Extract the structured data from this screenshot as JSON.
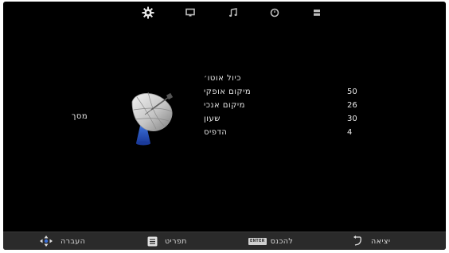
{
  "colors": {
    "background": "#000000",
    "text": "#e8e8e8",
    "bottom_bar": "#2a2a2a",
    "active_tab": "#e6e6e6"
  },
  "tabs": [
    {
      "icon": "gear-icon",
      "active": true
    },
    {
      "icon": "monitor-icon",
      "active": false
    },
    {
      "icon": "music-note-icon",
      "active": false
    },
    {
      "icon": "clock-icon",
      "active": false
    },
    {
      "icon": "lock-icon",
      "active": false
    }
  ],
  "section": {
    "label": "מסך",
    "icon": "satellite-dish-icon"
  },
  "menu": {
    "items": [
      {
        "label": "כיול אוטו׳",
        "value": ""
      },
      {
        "label": "מיקום אופקי",
        "value": "50"
      },
      {
        "label": "מיקום אנכי",
        "value": "26"
      },
      {
        "label": "שעון",
        "value": "30"
      },
      {
        "label": "הדפיס",
        "value": "4"
      }
    ]
  },
  "footer": {
    "move_label": "העברה",
    "menu_label": "תפריט",
    "enter_key": "ENTER",
    "enter_label": "להכנס",
    "exit_label": "יציאה"
  }
}
